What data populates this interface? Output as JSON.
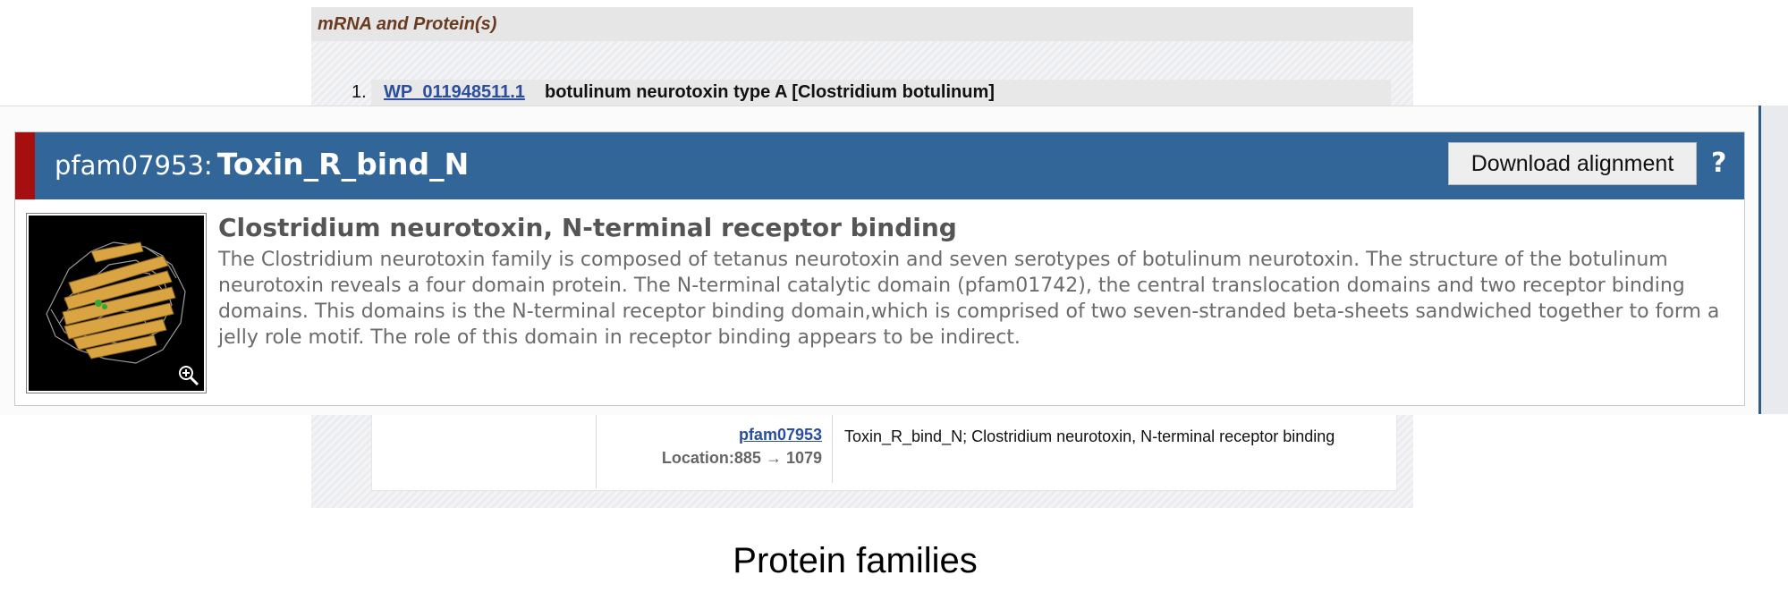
{
  "section": {
    "title": "mRNA and Protein(s)"
  },
  "protein_item": {
    "number": "1.",
    "accession": "WP_011948511.1",
    "description": "botulinum neurotoxin type A [Clostridium botulinum]"
  },
  "domain_row": {
    "pfam_link": "pfam07953",
    "location": "Location:885 → 1079",
    "description": "Toxin_R_bind_N; Clostridium neurotoxin, N-terminal receptor binding"
  },
  "popup": {
    "id_label": "pfam07953:",
    "name": "Toxin_R_bind_N",
    "download_label": "Download alignment",
    "help_label": "?",
    "family_title": "Clostridium neurotoxin, N-terminal receptor binding",
    "family_description": "The Clostridium neurotoxin family is composed of tetanus neurotoxin and seven serotypes of botulinum neurotoxin. The structure of the botulinum neurotoxin reveals a four domain protein. The N-terminal catalytic domain (pfam01742), the central translocation domains and two receptor binding domains. This domains is the N-terminal receptor binding domain,which is comprised of two seven-stranded beta-sheets sandwiched together to form a jelly role motif. The role of this domain in receptor binding appears to be indirect."
  },
  "caption": "Protein families",
  "colors": {
    "header_blue": "#326699",
    "accent_red": "#a60f0f",
    "link_blue": "#2b4e9e",
    "section_title_brown": "#6b3b20"
  },
  "icons": [
    "protein-structure-image",
    "zoom-icon"
  ]
}
